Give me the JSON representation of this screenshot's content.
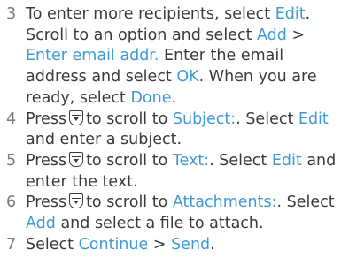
{
  "colors": {
    "text": "#3a3a3a",
    "step_number": "#7a7a7a",
    "link": "#3f9ad6"
  },
  "icons": {
    "scroll_key": "navigation-key-down-icon"
  },
  "steps": [
    {
      "number": "3",
      "t1": "To enter more recipients, select ",
      "l1": "Edit",
      "t2": ". Scroll to an option and select ",
      "l2": "Add",
      "t3": " > ",
      "l3": "Enter email addr.",
      "t4": " Enter the email address and select ",
      "l4": "OK",
      "t5": ". When you are ready, select ",
      "l5": "Done",
      "t6": "."
    },
    {
      "number": "4",
      "t1": "Press",
      "t2": "to scroll to ",
      "l1": "Subject:",
      "t3": ". Select ",
      "l2": "Edit",
      "t4": " and enter a subject."
    },
    {
      "number": "5",
      "t1": "Press",
      "t2": "to scroll to ",
      "l1": "Text:",
      "t3": ". Select ",
      "l2": "Edit",
      "t4": " and enter the text."
    },
    {
      "number": "6",
      "t1": "Press",
      "t2": "to scroll to ",
      "l1": "Attachments:",
      "t3": ". Select ",
      "l2": "Add",
      "t4": " and select a file to attach."
    },
    {
      "number": "7",
      "t1": "Select ",
      "l1": "Continue",
      "t2": " > ",
      "l2": "Send",
      "t3": "."
    }
  ]
}
